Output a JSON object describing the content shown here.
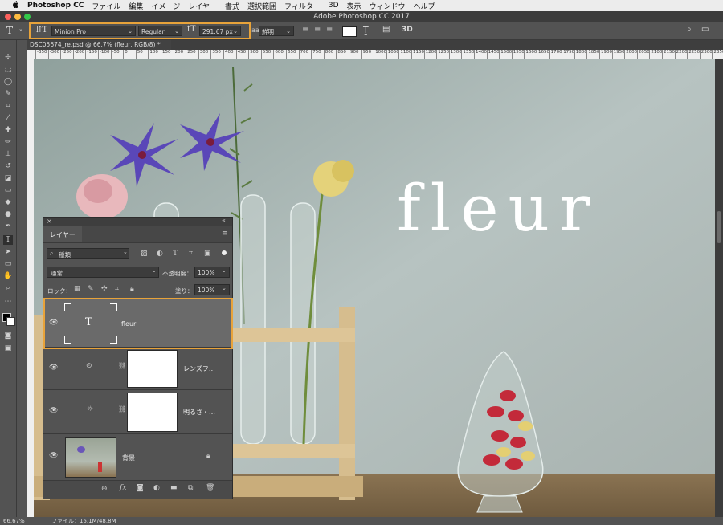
{
  "menubar": {
    "apple": "",
    "app_name": "Photoshop CC",
    "items": [
      "ファイル",
      "編集",
      "イメージ",
      "レイヤー",
      "書式",
      "選択範囲",
      "フィルター",
      "3D",
      "表示",
      "ウィンドウ",
      "ヘルプ"
    ]
  },
  "window": {
    "title": "Adobe Photoshop CC 2017"
  },
  "options_bar": {
    "tool_icon": "T",
    "font_family": "Minion Pro",
    "font_style": "Regular",
    "font_size": "291.67 px",
    "antialias": "鮮明",
    "threed_label": "3D"
  },
  "document": {
    "tab_title": "DSC05674_re.psd @ 66.7% (fleur, RGB/8) *",
    "canvas_text": "fleur",
    "ruler_marks": [
      "-350",
      "-300",
      "-250",
      "-200",
      "-150",
      "-100",
      "-50",
      "0",
      "50",
      "100",
      "150",
      "200",
      "250",
      "300",
      "350",
      "400",
      "450",
      "500",
      "550",
      "600",
      "650",
      "700",
      "750",
      "800",
      "850",
      "900",
      "950",
      "1000",
      "1050",
      "1100",
      "1150",
      "1200",
      "1250",
      "1300",
      "1350",
      "1400",
      "1450",
      "1500",
      "1550",
      "1600",
      "1650",
      "1700",
      "1750",
      "1800",
      "1850",
      "1900",
      "1950",
      "2000",
      "2050",
      "2100",
      "2150",
      "2200",
      "2250",
      "2300",
      "2350",
      "2400"
    ]
  },
  "status_bar": {
    "zoom": "66.67%",
    "file_info": "ファイル：15.1M/48.8M"
  },
  "layers_panel": {
    "tab_label": "レイヤー",
    "filter_value": "種類",
    "blend_mode": "通常",
    "opacity_label": "不透明度：",
    "opacity_value": "100%",
    "lock_label": "ロック：",
    "fill_label": "塗り：",
    "fill_value": "100%",
    "layers": [
      {
        "name": "fleur",
        "type": "text",
        "thumb_glyph": "T",
        "selected": true
      },
      {
        "name": "レンズフ…",
        "type": "adjustment",
        "selected": false
      },
      {
        "name": "明るさ・…",
        "type": "adjustment",
        "selected": false
      },
      {
        "name": "背景",
        "type": "background",
        "locked": true,
        "selected": false
      }
    ]
  },
  "colors": {
    "highlight": "#e8a33a",
    "panel": "#535353",
    "selected_row": "#6a6a6a"
  }
}
